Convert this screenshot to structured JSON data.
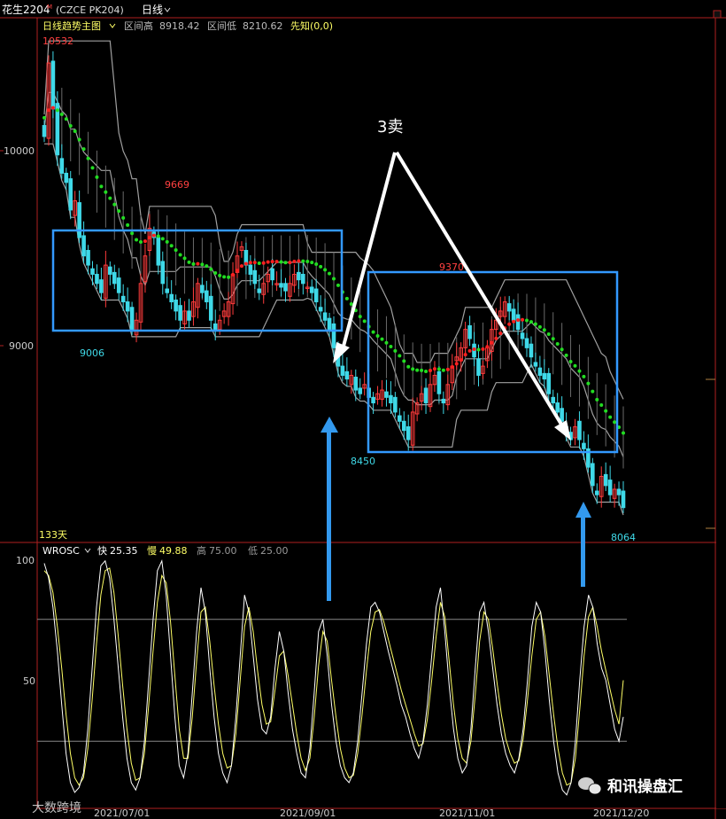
{
  "header": {
    "instrument": "花生2204",
    "instrument_sup": "M",
    "code": "(CZCE PK204)",
    "period": "日线"
  },
  "main_panel": {
    "indicator_name": "日线趋势主图",
    "range_high_label": "区间高",
    "range_high_value": "8918.42",
    "range_low_label": "区间低",
    "range_low_value": "8210.62",
    "prophet_label": "先知(0,0)",
    "days_label": "133天",
    "ann_high": "10532",
    "ann_9669": "9669",
    "ann_9006": "9006",
    "ann_9370": "9370",
    "ann_8450": "8450",
    "ann_8064": "8064",
    "sell_label": "3卖"
  },
  "sub_panel": {
    "indicator_name": "WROSC",
    "fast_label": "快",
    "fast_value": "25.35",
    "slow_label": "慢",
    "slow_value": "49.88",
    "high_label": "高",
    "high_value": "75.00",
    "low_label": "低",
    "low_value": "25.00"
  },
  "x_axis_labels": [
    "2021/07/01",
    "2021/09/01",
    "2021/11/01",
    "2021/12/20"
  ],
  "watermark_left": "大数跨境",
  "watermark_right": "和讯操盘汇",
  "colors": {
    "up_candle": "#ff3b3b",
    "down_candle": "#3fd9e8",
    "trend_green": "#22dd22",
    "trend_red": "#ff2020",
    "box_blue": "#3399ff",
    "band_gray": "#a0a0a0",
    "fast_line": "#ffffff",
    "slow_line": "#ffff66"
  },
  "chart_data": [
    {
      "type": "candlestick",
      "title": "日线趋势主图",
      "y_ticks": [
        "10000",
        "9000"
      ],
      "ylim": [
        7900,
        10650
      ],
      "x_labels": [
        "2021/07/01",
        "2021/09/01",
        "2021/11/01",
        "2021/12/20"
      ],
      "annotated_prices": {
        "max": 10532,
        "low_jul": 9006,
        "high_jul": 9669,
        "low_oct": 8450,
        "high_nov": 9370,
        "last_low": 8064
      },
      "close": [
        10100,
        10500,
        10250,
        10000,
        9900,
        9850,
        9700,
        9750,
        9550,
        9450,
        9400,
        9350,
        9300,
        9250,
        9400,
        9350,
        9300,
        9250,
        9200,
        9150,
        9050,
        9100,
        9300,
        9450,
        9600,
        9550,
        9400,
        9300,
        9250,
        9200,
        9150,
        9100,
        9150,
        9100,
        9200,
        9300,
        9250,
        9200,
        9100,
        9050,
        9100,
        9150,
        9200,
        9350,
        9450,
        9500,
        9400,
        9350,
        9300,
        9250,
        9300,
        9350,
        9320,
        9300,
        9280,
        9260,
        9300,
        9350,
        9320,
        9300,
        9280,
        9250,
        9200,
        9150,
        9100,
        9050,
        8950,
        8850,
        8800,
        8780,
        8800,
        8720,
        8700,
        8750,
        8680,
        8650,
        8700,
        8720,
        8680,
        8650,
        8600,
        8550,
        8500,
        8450,
        8600,
        8650,
        8700,
        8650,
        8750,
        8800,
        8700,
        8650,
        8750,
        8850,
        8900,
        8950,
        9050,
        9000,
        8900,
        8800,
        8850,
        8950,
        9050,
        9100,
        9150,
        9200,
        9150,
        9100,
        9050,
        9000,
        8950,
        8900,
        8850,
        8800,
        8780,
        8700,
        8650,
        8600,
        8550,
        8500,
        8450,
        8520,
        8450,
        8400,
        8300,
        8200,
        8150,
        8250,
        8200,
        8150,
        8180,
        8150,
        8080
      ],
      "wrosc": {
        "levels": {
          "high": 75.0,
          "low": 25.0
        },
        "ylim": [
          0,
          100
        ],
        "fast_last": 25.35,
        "slow_last": 49.88,
        "fast": [
          98,
          92,
          80,
          62,
          40,
          20,
          8,
          4,
          6,
          12,
          30,
          55,
          80,
          97,
          99,
          92,
          75,
          55,
          35,
          18,
          8,
          5,
          10,
          25,
          50,
          75,
          95,
          99,
          85,
          60,
          35,
          15,
          10,
          20,
          45,
          70,
          88,
          78,
          55,
          35,
          20,
          12,
          8,
          15,
          35,
          60,
          85,
          78,
          60,
          42,
          30,
          28,
          35,
          55,
          70,
          62,
          45,
          30,
          20,
          12,
          10,
          22,
          45,
          70,
          75,
          60,
          40,
          25,
          15,
          10,
          8,
          12,
          25,
          45,
          65,
          80,
          82,
          78,
          70,
          62,
          55,
          48,
          40,
          35,
          28,
          22,
          18,
          25,
          40,
          60,
          80,
          88,
          70,
          48,
          30,
          18,
          12,
          15,
          30,
          55,
          78,
          82,
          70,
          55,
          40,
          28,
          20,
          15,
          12,
          18,
          30,
          50,
          72,
          82,
          78,
          62,
          42,
          25,
          12,
          5,
          3,
          8,
          25,
          50,
          72,
          85,
          80,
          65,
          55,
          50,
          40,
          30,
          25,
          35
        ],
        "slow": [
          95,
          93,
          86,
          72,
          55,
          36,
          20,
          10,
          7,
          10,
          22,
          42,
          65,
          85,
          95,
          96,
          86,
          68,
          48,
          30,
          16,
          9,
          10,
          20,
          40,
          62,
          82,
          93,
          90,
          74,
          52,
          30,
          18,
          18,
          35,
          58,
          78,
          80,
          66,
          48,
          32,
          20,
          14,
          15,
          28,
          50,
          72,
          80,
          70,
          54,
          40,
          32,
          33,
          46,
          60,
          62,
          52,
          40,
          28,
          18,
          13,
          18,
          35,
          56,
          70,
          66,
          50,
          35,
          22,
          14,
          10,
          11,
          20,
          36,
          54,
          70,
          78,
          79,
          74,
          67,
          60,
          53,
          46,
          40,
          34,
          28,
          23,
          24,
          34,
          50,
          68,
          82,
          76,
          58,
          40,
          26,
          18,
          16,
          25,
          44,
          66,
          78,
          75,
          63,
          49,
          36,
          26,
          20,
          16,
          17,
          26,
          42,
          60,
          75,
          78,
          68,
          52,
          36,
          22,
          12,
          7,
          8,
          18,
          38,
          60,
          76,
          80,
          72,
          62,
          54,
          46,
          38,
          32,
          50
        ]
      }
    }
  ]
}
